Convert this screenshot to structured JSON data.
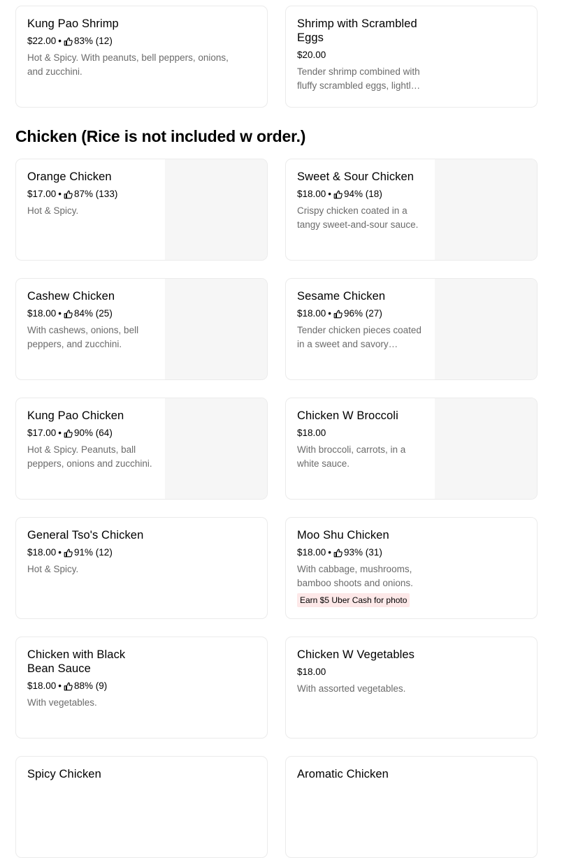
{
  "top_items": [
    {
      "name": "Kung Pao Shrimp",
      "price": "$22.00",
      "rating": "83% (12)",
      "desc": "Hot & Spicy. With peanuts, bell peppers, onions, and zucchini."
    },
    {
      "name": "Shrimp with Scrambled Eggs",
      "price": "$20.00",
      "desc": "Tender shrimp combined with fluffy scrambled eggs, lightly seasoned."
    }
  ],
  "section": {
    "title": "Chicken (Rice is not included w order.)"
  },
  "chicken_items": [
    {
      "name": "Orange Chicken",
      "price": "$17.00",
      "rating": "87% (133)",
      "desc": "Hot & Spicy."
    },
    {
      "name": "Sweet & Sour Chicken",
      "price": "$18.00",
      "rating": "94% (18)",
      "desc": "Crispy chicken coated in a tangy sweet-and-sour sauce."
    },
    {
      "name": "Cashew Chicken",
      "price": "$18.00",
      "rating": "84% (25)",
      "desc": "With cashews, onions, bell peppers, and zucchini."
    },
    {
      "name": "Sesame Chicken",
      "price": "$18.00",
      "rating": "96% (27)",
      "desc": "Tender chicken pieces coated in a sweet and savory sesame sauce."
    },
    {
      "name": "Kung Pao Chicken",
      "price": "$17.00",
      "rating": "90% (64)",
      "desc": "Hot & Spicy. Peanuts, ball peppers, onions and zucchini."
    },
    {
      "name": "Chicken W Broccoli",
      "price": "$18.00",
      "desc": "With broccoli, carrots, in a white sauce."
    },
    {
      "name": "General Tso's Chicken",
      "price": "$18.00",
      "rating": "91% (12)",
      "desc": "Hot & Spicy."
    },
    {
      "name": "Moo Shu Chicken",
      "price": "$18.00",
      "rating": "93% (31)",
      "desc": "With cabbage, mushrooms, bamboo shoots and onions.",
      "promo": "Earn $5 Uber Cash for photo"
    },
    {
      "name": "Chicken with Black Bean Sauce",
      "price": "$18.00",
      "rating": "88% (9)",
      "desc": "With vegetables."
    },
    {
      "name": "Chicken W Vegetables",
      "price": "$18.00",
      "desc": "With assorted vegetables."
    },
    {
      "name": "Spicy Chicken"
    },
    {
      "name": "Aromatic Chicken"
    }
  ],
  "icons": {
    "rating": "thumbs-up-icon"
  },
  "colors": {
    "promo_bg": "#fde8e8",
    "muted_text": "#6b6b6b",
    "card_border": "#ebebeb",
    "thumb_bg": "#f6f6f6"
  }
}
